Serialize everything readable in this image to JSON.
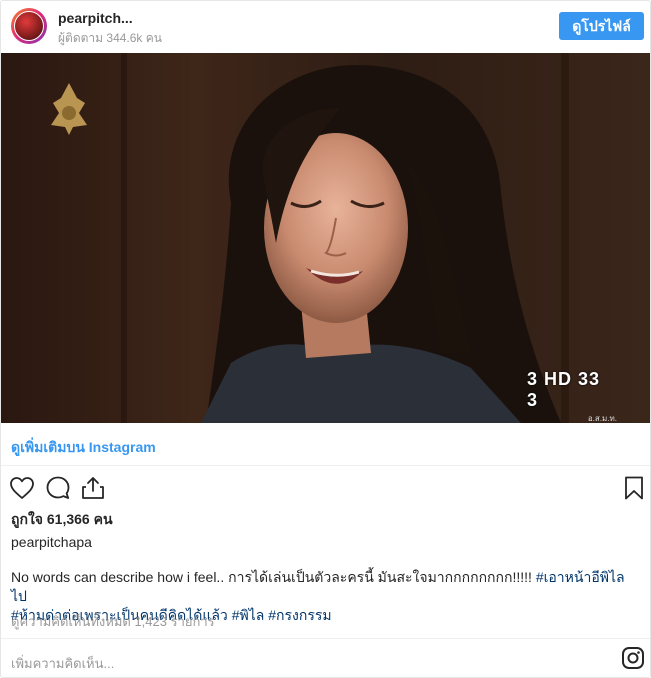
{
  "header": {
    "username": "pearpitch...",
    "followers": "ผู้ติดตาม 344.6k คน",
    "profile_button": "ดูโปรไฟล์"
  },
  "photo": {
    "channel_badge": "3 HD 33 3",
    "channel_caption": "อ.ส.ม.ท."
  },
  "view_more": "ดูเพิ่มเติมบน Instagram",
  "actions": {
    "like_icon": "heart-icon",
    "comment_icon": "comment-icon",
    "share_icon": "share-icon",
    "save_icon": "bookmark-icon"
  },
  "likes": "ถูกใจ 61,366 คน",
  "poster": "pearpitchapa",
  "caption": {
    "text": "No words can describe how i feel.. การได้เล่นเป็นตัวละครนี้ มันสะใจมากกกกกกกก!!!!! ",
    "hashtags": [
      "#เอาหน้าอีพิไลไป",
      "#ห้ามด่าต่อเพราะเป็นคนดีคิดได้แล้ว",
      "#พิไล",
      "#กรงกรรม"
    ]
  },
  "comments_link": "ดูความคิดเห็นทั้งหมด 1,423 รายการ",
  "add_comment_placeholder": "เพิ่มความคิดเห็น...",
  "colors": {
    "accent": "#3897f0",
    "hashtag": "#003569",
    "muted": "#999999"
  }
}
